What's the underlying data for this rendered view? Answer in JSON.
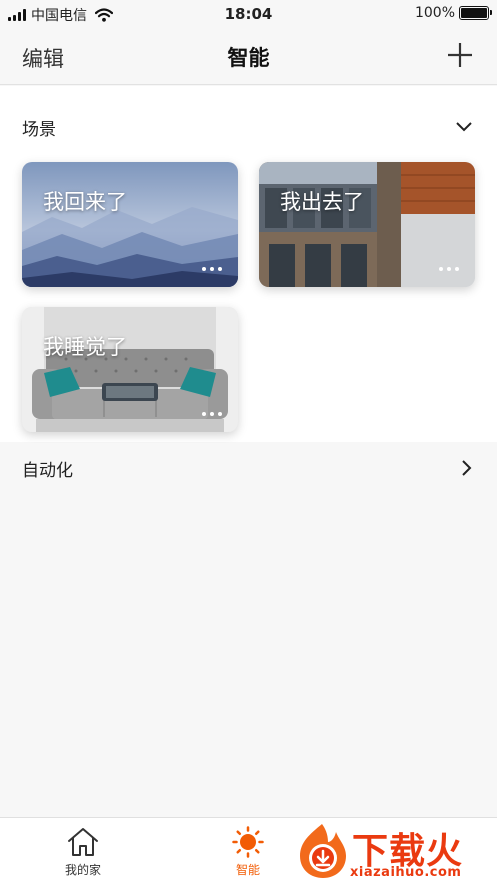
{
  "status_bar": {
    "carrier": "中国电信",
    "time": "18:04",
    "battery": "100%",
    "battery_level": 1.0
  },
  "nav": {
    "edit_label": "编辑",
    "title": "智能",
    "add_icon": "plus-icon"
  },
  "scenes": {
    "header": "场景",
    "header_icon": "chevron-down-icon",
    "items": [
      {
        "label": "我回来了",
        "background": "misty-mountains",
        "more_icon": "more-dots-icon"
      },
      {
        "label": "我出去了",
        "background": "building-facade",
        "more_icon": "more-dots-icon"
      },
      {
        "label": "我睡觉了",
        "background": "living-room-sofa",
        "more_icon": "more-dots-icon"
      }
    ]
  },
  "automation": {
    "header": "自动化",
    "header_icon": "chevron-right-icon"
  },
  "tab_bar": {
    "tabs": [
      {
        "label": "我的家",
        "icon": "home-icon",
        "active": false
      },
      {
        "label": "智能",
        "icon": "sun-icon",
        "active": true
      }
    ]
  },
  "watermark": {
    "text": "下载火",
    "url": "xiazaihuo.com",
    "icon": "fire-logo-icon"
  },
  "colors": {
    "accent": "#f25c05",
    "background": "#f7f7f7",
    "watermark": "#ea3a10"
  }
}
